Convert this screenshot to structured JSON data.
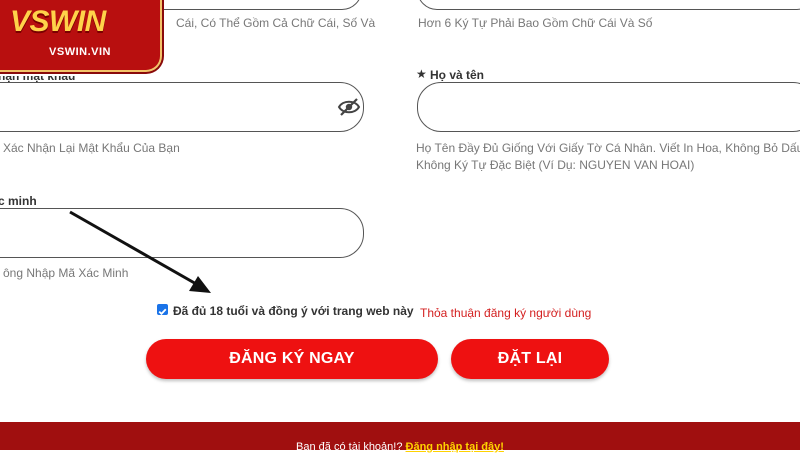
{
  "logo": {
    "main": "VSWIN",
    "sub": "VSWIN.VIN"
  },
  "hints": {
    "top_left": "Cái, Có Thể Gồm Cả Chữ Cái, Số Và",
    "top_right": "Hơn 6 Ký Tự Phải Bao Gồm Chữ Cái Và Số",
    "confirm_password": "Xác Nhận Lại Mật Khẩu Của Bạn",
    "fullname_line1": "Họ Tên Đầy Đủ Giống Với Giấy Tờ Cá Nhân. Viết In Hoa, Không Bỏ Dấu,",
    "fullname_line2": "Không Ký Tự Đặc Biệt (Ví Dụ: NGUYEN VAN HOAI)",
    "captcha": "ông Nhập Mã Xác Minh"
  },
  "labels": {
    "confirm_password": "hận mật khẩu",
    "fullname": "Họ và tên",
    "captcha": "c minh"
  },
  "checkbox": {
    "label": "Đã đủ 18 tuổi và đồng ý với trang web này",
    "checked": true
  },
  "terms_link": "Thỏa thuận đăng ký người dùng",
  "buttons": {
    "register": "ĐĂNG KÝ NGAY",
    "reset": "ĐẶT LẠI"
  },
  "footer": {
    "question": "Bạn đã có tài khoản!?",
    "login_link": "Đăng nhập tại đây!"
  },
  "colors": {
    "accent": "#ee1111",
    "footer_bg": "#a00f0f",
    "link_red": "#d42020",
    "login_yellow": "#ffd200"
  }
}
